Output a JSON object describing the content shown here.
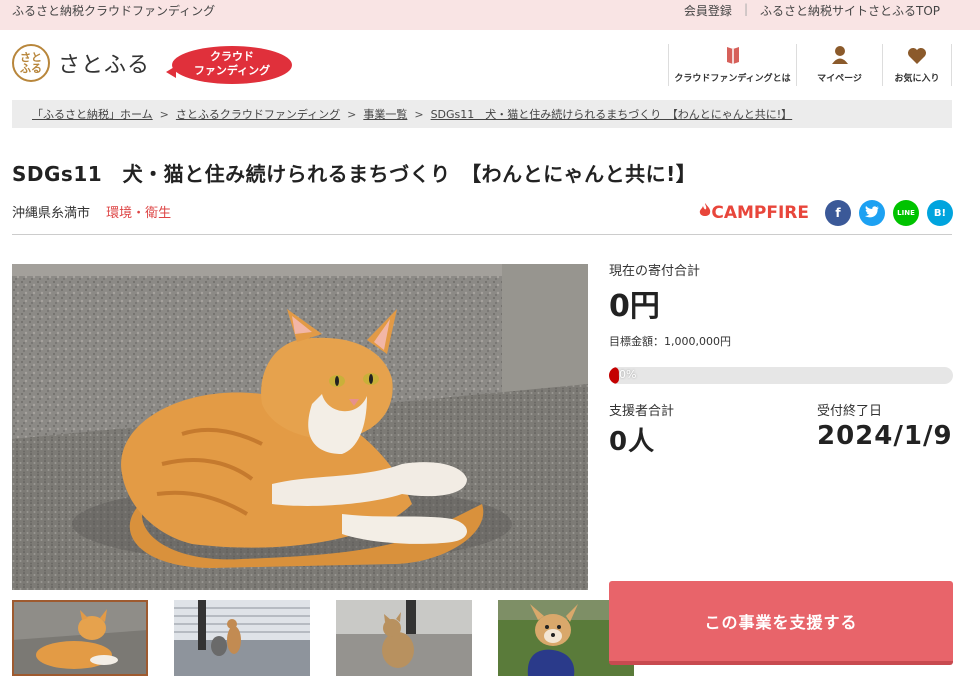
{
  "topbar": {
    "site_text": "ふるさと納税クラウドファンディング",
    "links": [
      "会員登録",
      "ふるさと納税サイトさとふるTOP"
    ]
  },
  "header": {
    "logo_mark": "さと ふる",
    "logo_word": "さとふる",
    "cf_badge_line1": "クラウド",
    "cf_badge_line2": "ファンディング",
    "nav": [
      {
        "label": "クラウドファンディングとは",
        "icon": "book-icon"
      },
      {
        "label": "マイページ",
        "icon": "person-icon"
      },
      {
        "label": "お気に入り",
        "icon": "heart-icon"
      }
    ]
  },
  "breadcrumb": [
    "「ふるさと納税」ホーム",
    "さとふるクラウドファンディング",
    "事業一覧",
    "SDGs11　犬・猫と住み続けられるまちづくり　【わんとにゃんと共に!】"
  ],
  "project": {
    "title": "SDGs11　犬・猫と住み続けられるまちづくり　【わんとにゃんと共に!】",
    "location": "沖縄県糸満市",
    "category": "環境・衛生",
    "partner": "CAMPFIRE"
  },
  "share": [
    {
      "name": "facebook",
      "glyph": "f"
    },
    {
      "name": "twitter",
      "glyph": "t"
    },
    {
      "name": "line",
      "glyph": "LINE"
    },
    {
      "name": "hatena",
      "glyph": "B!"
    }
  ],
  "stats": {
    "current_label": "現在の寄付合計",
    "current_amount": "0円",
    "goal_text": "目標金額：1,000,000円",
    "progress_text": "0%",
    "progress_fraction": 0,
    "supporters_label": "支援者合計",
    "supporters_value": "0人",
    "deadline_label": "受付終了日",
    "deadline_value": "2024/1/9"
  },
  "cta": {
    "label": "この事業を支援する"
  },
  "colors": {
    "accent": "#e8646a",
    "topbar": "#f9e4e4",
    "campfire": "#e8463b",
    "badge": "#e0303b"
  }
}
